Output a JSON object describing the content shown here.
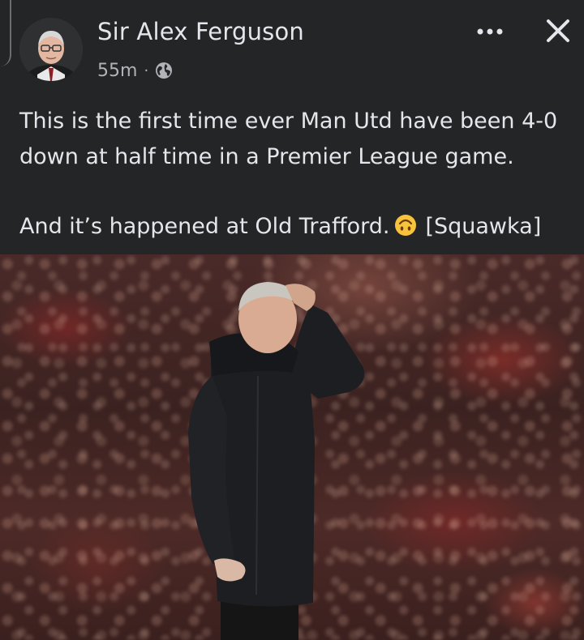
{
  "post": {
    "author_name": "Sir Alex Ferguson",
    "timestamp": "55m",
    "separator": "·",
    "audience_icon": "globe-icon",
    "text_line_1": "This is the first time ever Man Utd have been 4-0 down at half time in a Premier League game.",
    "text_line_2_before_emoji": "And it’s happened at Old Trafford.",
    "emoji": "upside-down-face-emoji",
    "text_line_2_after_emoji": "[Squawka]"
  },
  "header": {
    "more_icon": "more-options-icon",
    "close_icon": "close-icon"
  },
  "colors": {
    "background": "#242526",
    "text_primary": "#e4e6eb",
    "text_secondary": "#b0b3b8",
    "emoji_yellow": "#f7c33a"
  }
}
